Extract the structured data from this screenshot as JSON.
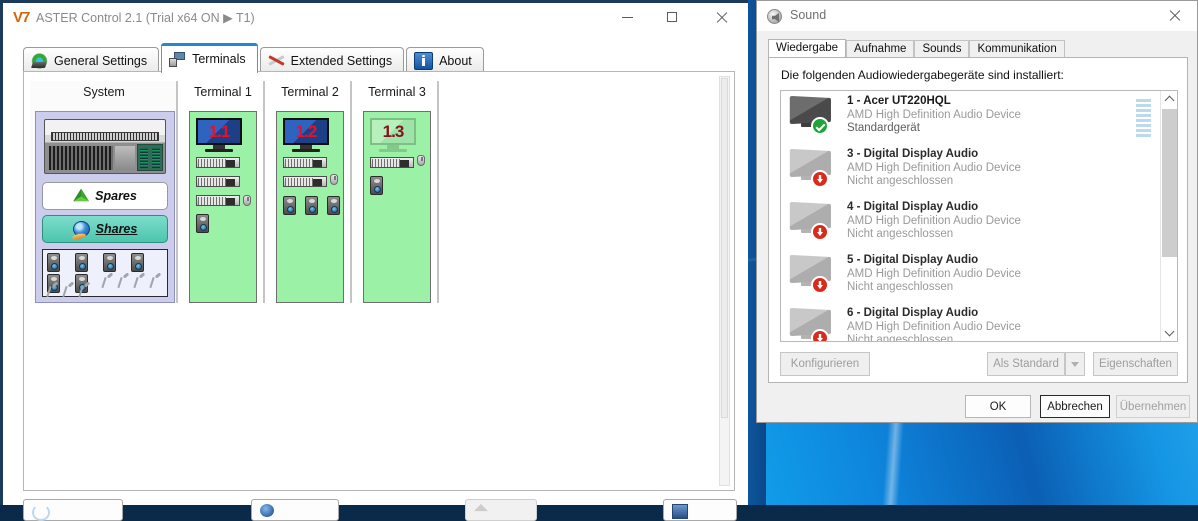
{
  "aster": {
    "title": "ASTER Control 2.1 (Trial x64 ON ▶ T1)",
    "logo": "V7",
    "window_controls": {
      "minimize": "minimize-icon",
      "maximize": "maximize-icon",
      "close": "close-icon"
    },
    "tabs": [
      {
        "label": "General Settings",
        "icon": "gear-icon",
        "active": false
      },
      {
        "label": "Terminals",
        "icon": "terminal-monitor-icon",
        "active": true
      },
      {
        "label": "Extended Settings",
        "icon": "tools-icon",
        "active": false
      },
      {
        "label": "About",
        "icon": "info-icon",
        "active": false
      }
    ],
    "columns": [
      {
        "header": "System",
        "type": "system",
        "pills": [
          {
            "label": "Spares",
            "icon": "recycle-icon",
            "selected": false
          },
          {
            "label": "Shares",
            "icon": "globe-icon",
            "selected": true
          }
        ],
        "device_tray": {
          "speakers": 6,
          "microphones": 7
        }
      },
      {
        "header": "Terminal 1",
        "type": "terminal",
        "monitor_label": "1.1",
        "monitor_active": true,
        "keyboards": 3,
        "mice": 1,
        "speakers": 1
      },
      {
        "header": "Terminal 2",
        "type": "terminal",
        "monitor_label": "1.2",
        "monitor_active": true,
        "keyboards": 2,
        "mice": 1,
        "speakers": 3
      },
      {
        "header": "Terminal 3",
        "type": "terminal",
        "monitor_label": "1.3",
        "monitor_active": false,
        "keyboards": 1,
        "mice": 1,
        "speakers": 1
      }
    ],
    "bottom_buttons": [
      "",
      "",
      "",
      ""
    ]
  },
  "sound": {
    "title": "Sound",
    "icon": "speaker-icon",
    "close": "close-icon",
    "tabs": [
      {
        "label": "Wiedergabe",
        "active": true
      },
      {
        "label": "Aufnahme",
        "active": false
      },
      {
        "label": "Sounds",
        "active": false
      },
      {
        "label": "Kommunikation",
        "active": false
      }
    ],
    "caption": "Die folgenden Audiowiedergabegeräte sind installiert:",
    "devices": [
      {
        "name": "1 - Acer UT220HQL",
        "driver": "AMD High Definition Audio Device",
        "status": "Standardgerät",
        "badge": "default-check",
        "muted": false,
        "meter": true
      },
      {
        "name": "3 - Digital Display Audio",
        "driver": "AMD High Definition Audio Device",
        "status": "Nicht angeschlossen",
        "badge": "disconnected-arrow",
        "muted": true,
        "meter": false
      },
      {
        "name": "4 - Digital Display Audio",
        "driver": "AMD High Definition Audio Device",
        "status": "Nicht angeschlossen",
        "badge": "disconnected-arrow",
        "muted": true,
        "meter": false
      },
      {
        "name": "5 - Digital Display Audio",
        "driver": "AMD High Definition Audio Device",
        "status": "Nicht angeschlossen",
        "badge": "disconnected-arrow",
        "muted": true,
        "meter": false
      },
      {
        "name": "6 - Digital Display Audio",
        "driver": "AMD High Definition Audio Device",
        "status": "Nicht angeschlossen",
        "badge": "disconnected-arrow",
        "muted": true,
        "meter": false
      }
    ],
    "buttons": {
      "configure": "Konfigurieren",
      "set_default": "Als Standard",
      "properties": "Eigenschaften",
      "ok": "OK",
      "cancel": "Abbrechen",
      "apply": "Übernehmen"
    }
  },
  "colors": {
    "terminal_bg": "#9bf2a6",
    "shares_accent": "#4bc6ae",
    "active_tab_accent": "#1d8bd1",
    "monitor_number": "#e8112d",
    "default_badge": "#21a33a",
    "disconnected_badge": "#d92b1c",
    "desktop": "#13a9f0"
  }
}
